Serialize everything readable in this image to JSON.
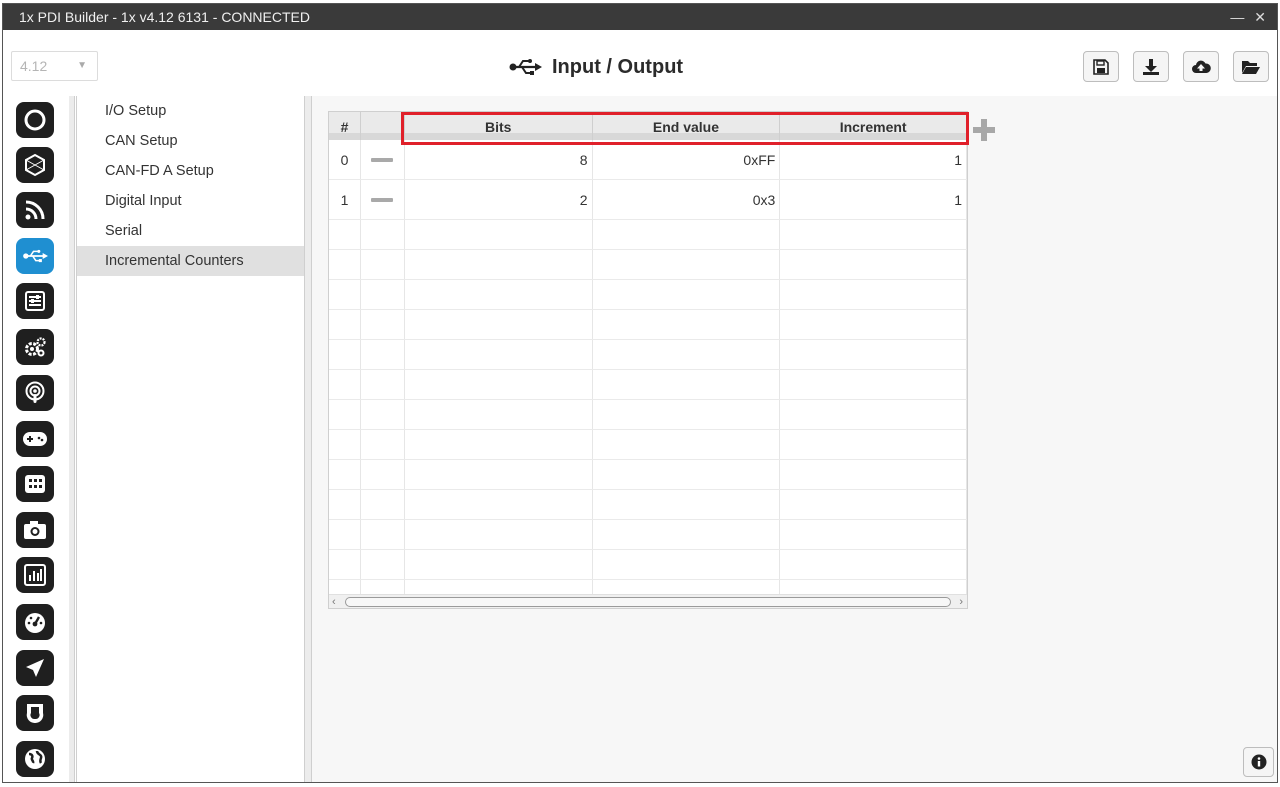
{
  "window": {
    "title": "1x PDI Builder - 1x v4.12 6131 - CONNECTED",
    "controls": "— ✕"
  },
  "header": {
    "version": "4.12",
    "title": "Input / Output",
    "toolbar": [
      "save-icon",
      "download-icon",
      "cloud-upload-icon",
      "open-folder-icon"
    ]
  },
  "nav_icons": [
    "power-icon",
    "box-icon",
    "rss-icon",
    "usb-icon",
    "sliders-icon",
    "gears-icon",
    "podcast-icon",
    "gamepad-icon",
    "grid-icon",
    "camera-icon",
    "bar-chart-icon",
    "gauge-icon",
    "plane-icon",
    "shield-icon",
    "globe-icon"
  ],
  "submenu": {
    "items": [
      {
        "label": "I/O Setup"
      },
      {
        "label": "CAN Setup"
      },
      {
        "label": "CAN-FD A Setup"
      },
      {
        "label": "Digital Input"
      },
      {
        "label": "Serial"
      },
      {
        "label": "Incremental Counters"
      }
    ]
  },
  "table": {
    "columns": [
      "#",
      "",
      "Bits",
      "End value",
      "Increment"
    ],
    "rows": [
      {
        "index": "0",
        "bits": "8",
        "end_value": "0xFF",
        "increment": "1"
      },
      {
        "index": "1",
        "bits": "2",
        "end_value": "0x3",
        "increment": "1"
      }
    ]
  },
  "colors": {
    "accent": "#1f8fd1",
    "highlight": "#e0202a",
    "titlebar": "#3a3a3a"
  }
}
